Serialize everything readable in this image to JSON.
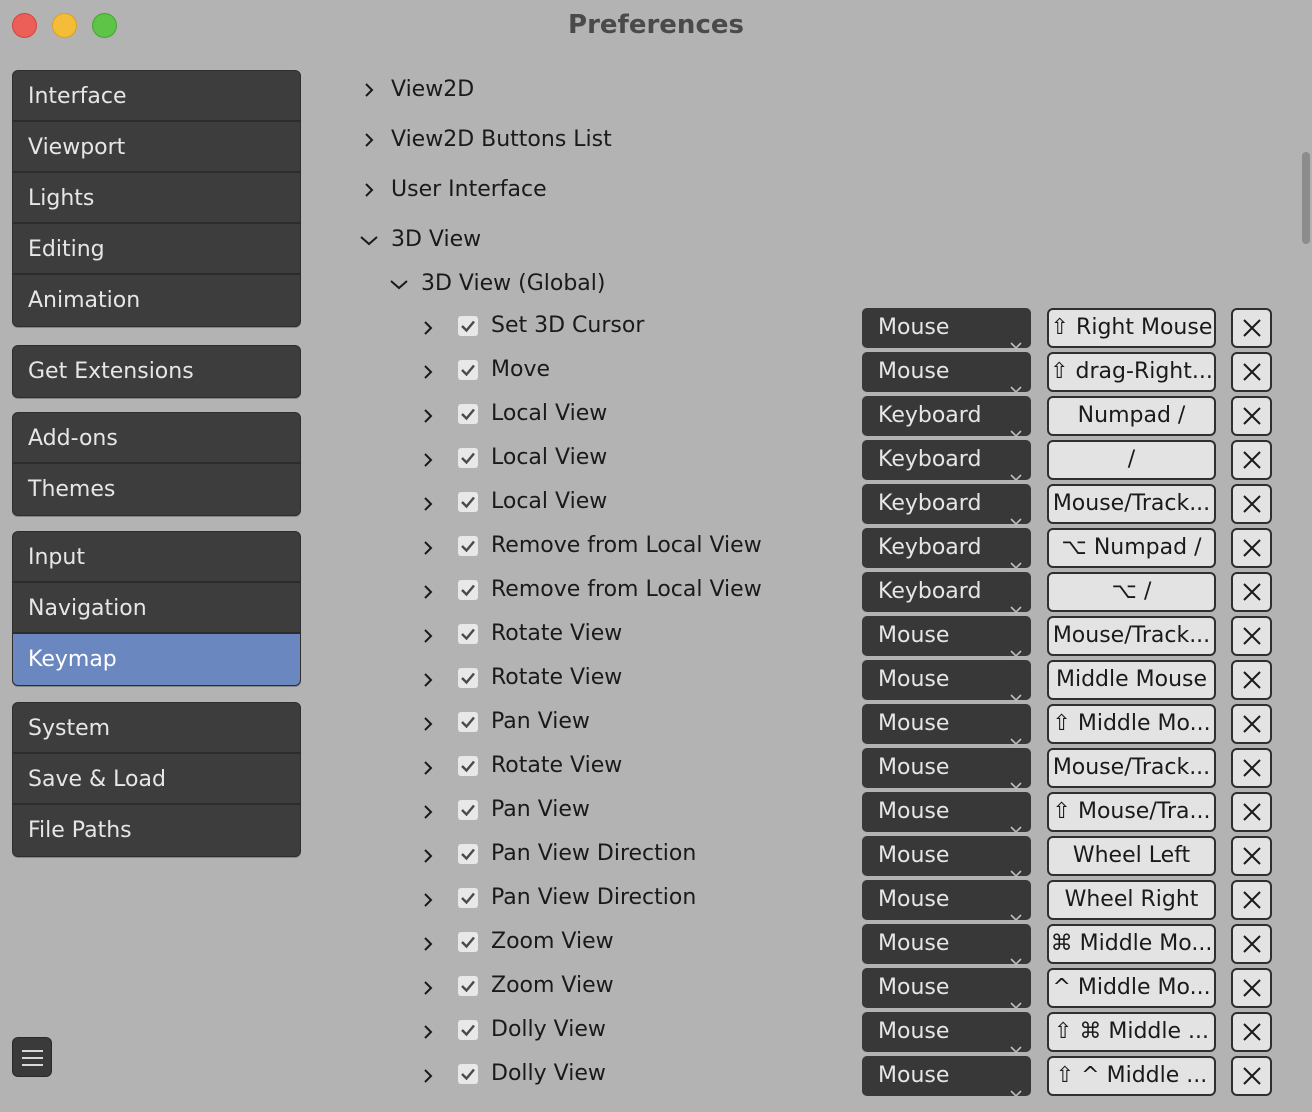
{
  "window": {
    "title": "Preferences"
  },
  "sidebar": {
    "groups": [
      {
        "items": [
          {
            "label": "Interface"
          },
          {
            "label": "Viewport"
          },
          {
            "label": "Lights"
          },
          {
            "label": "Editing"
          },
          {
            "label": "Animation"
          }
        ]
      },
      {
        "items": [
          {
            "label": "Get Extensions"
          }
        ]
      },
      {
        "items": [
          {
            "label": "Add-ons"
          },
          {
            "label": "Themes"
          }
        ]
      },
      {
        "items": [
          {
            "label": "Input"
          },
          {
            "label": "Navigation"
          },
          {
            "label": "Keymap",
            "active": true
          }
        ]
      },
      {
        "items": [
          {
            "label": "System"
          },
          {
            "label": "Save & Load"
          },
          {
            "label": "File Paths"
          }
        ]
      }
    ]
  },
  "tree": {
    "sections": [
      {
        "label": "View2D",
        "expanded": false
      },
      {
        "label": "View2D Buttons List",
        "expanded": false
      },
      {
        "label": "User Interface",
        "expanded": false
      },
      {
        "label": "3D View",
        "expanded": true
      }
    ],
    "subsection": {
      "label": "3D View (Global)",
      "expanded": true
    }
  },
  "keymap_items": [
    {
      "label": "Set 3D Cursor",
      "enabled": true,
      "type": "Mouse",
      "key": "⇧ Right Mouse"
    },
    {
      "label": "Move",
      "enabled": true,
      "type": "Mouse",
      "key": "⇧ drag-Right..."
    },
    {
      "label": "Local View",
      "enabled": true,
      "type": "Keyboard",
      "key": "Numpad /"
    },
    {
      "label": "Local View",
      "enabled": true,
      "type": "Keyboard",
      "key": "/"
    },
    {
      "label": "Local View",
      "enabled": true,
      "type": "Keyboard",
      "key": "Mouse/Track..."
    },
    {
      "label": "Remove from Local View",
      "enabled": true,
      "type": "Keyboard",
      "key": "⌥ Numpad /"
    },
    {
      "label": "Remove from Local View",
      "enabled": true,
      "type": "Keyboard",
      "key": "⌥ /"
    },
    {
      "label": "Rotate View",
      "enabled": true,
      "type": "Mouse",
      "key": "Mouse/Track..."
    },
    {
      "label": "Rotate View",
      "enabled": true,
      "type": "Mouse",
      "key": "Middle Mouse"
    },
    {
      "label": "Pan View",
      "enabled": true,
      "type": "Mouse",
      "key": "⇧ Middle Mo..."
    },
    {
      "label": "Rotate View",
      "enabled": true,
      "type": "Mouse",
      "key": "Mouse/Track..."
    },
    {
      "label": "Pan View",
      "enabled": true,
      "type": "Mouse",
      "key": "⇧ Mouse/Tra..."
    },
    {
      "label": "Pan View Direction",
      "enabled": true,
      "type": "Mouse",
      "key": "Wheel Left"
    },
    {
      "label": "Pan View Direction",
      "enabled": true,
      "type": "Mouse",
      "key": "Wheel Right"
    },
    {
      "label": "Zoom View",
      "enabled": true,
      "type": "Mouse",
      "key": "⌘ Middle Mo..."
    },
    {
      "label": "Zoom View",
      "enabled": true,
      "type": "Mouse",
      "key": "^ Middle Mo..."
    },
    {
      "label": "Dolly View",
      "enabled": true,
      "type": "Mouse",
      "key": "⇧ ⌘ Middle ..."
    },
    {
      "label": "Dolly View",
      "enabled": true,
      "type": "Mouse",
      "key": "⇧ ^ Middle ..."
    }
  ]
}
